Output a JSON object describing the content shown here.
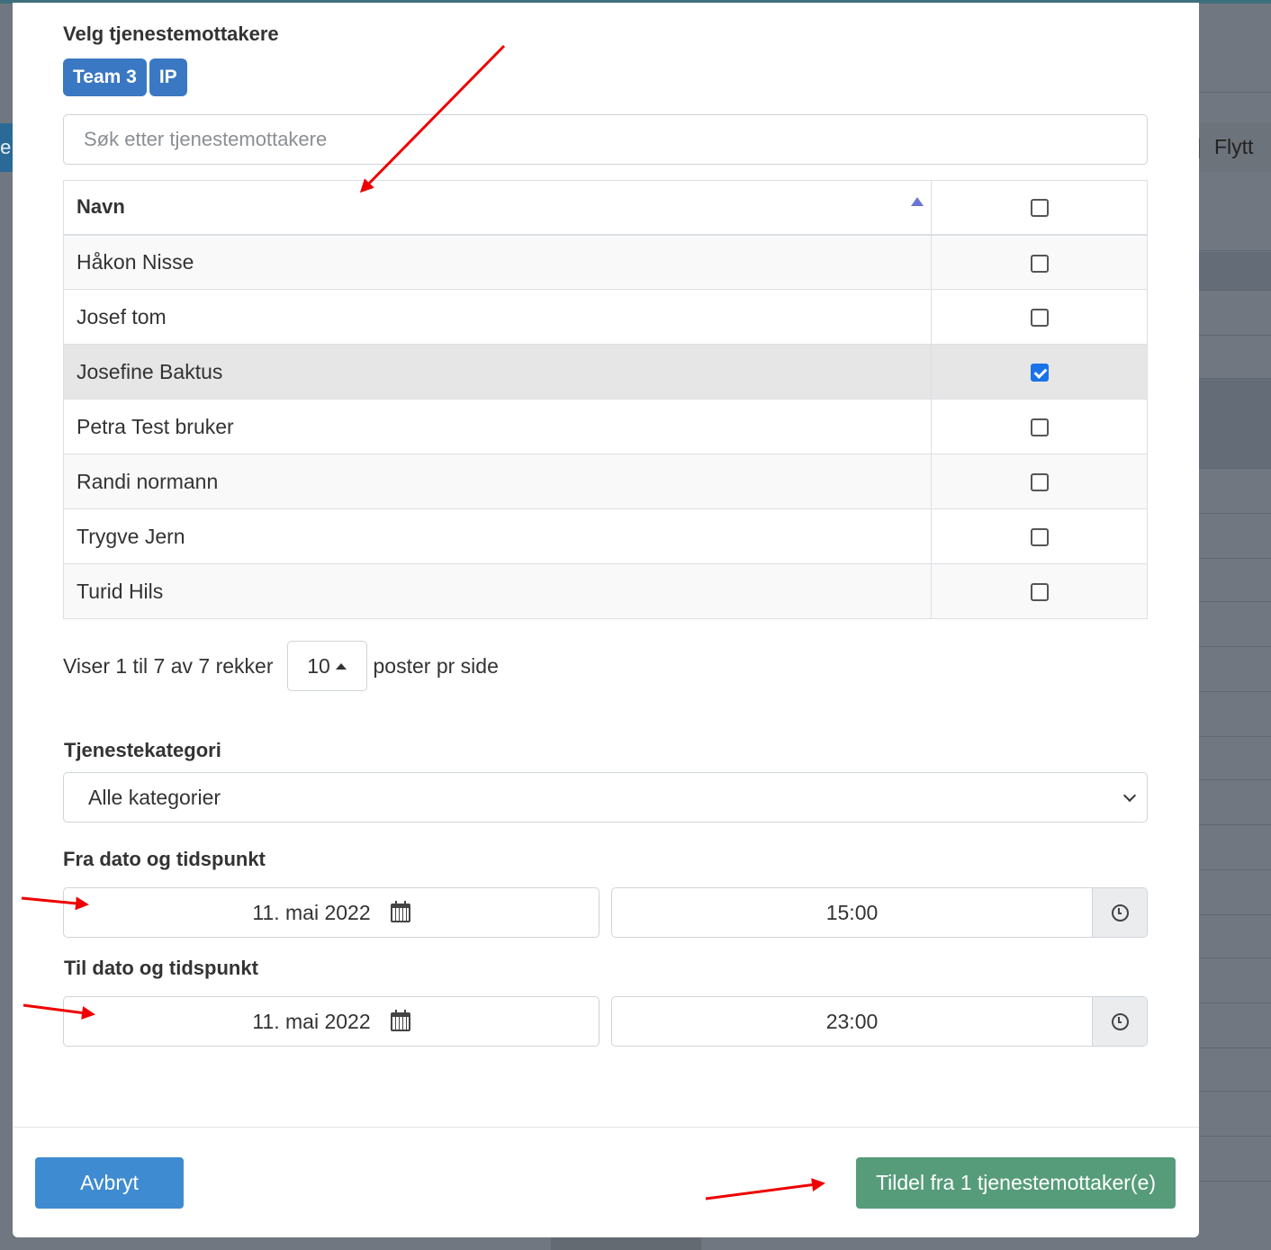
{
  "background": {
    "left_tab_text": "te",
    "right_button_label": "Flytt"
  },
  "modal": {
    "recipients_label": "Velg tjenestemottakere",
    "badges": [
      "Team 3",
      "IP"
    ],
    "search": {
      "placeholder": "Søk etter tjenestemottakere",
      "value": ""
    },
    "table": {
      "column_name": "Navn",
      "rows": [
        {
          "name": "Håkon Nisse",
          "checked": false
        },
        {
          "name": "Josef tom",
          "checked": false
        },
        {
          "name": "Josefine Baktus",
          "checked": true
        },
        {
          "name": "Petra Test bruker",
          "checked": false
        },
        {
          "name": "Randi normann",
          "checked": false
        },
        {
          "name": "Trygve Jern",
          "checked": false
        },
        {
          "name": "Turid Hils",
          "checked": false
        }
      ]
    },
    "pagination": {
      "summary": "Viser 1 til 7 av 7 rekker",
      "page_size": "10",
      "suffix": "poster pr side"
    },
    "category": {
      "label": "Tjenestekategori",
      "selected": "Alle kategorier"
    },
    "from": {
      "label": "Fra dato og tidspunkt",
      "date": "11. mai 2022",
      "time": "15:00"
    },
    "to": {
      "label": "Til dato og tidspunkt",
      "date": "11. mai 2022",
      "time": "23:00"
    },
    "buttons": {
      "cancel": "Avbryt",
      "assign": "Tildel fra 1 tjenestemottaker(e)"
    }
  },
  "colors": {
    "badge": "#3a78c3",
    "cancel_button": "#3e8bd1",
    "assign_button": "#569c7a",
    "annotation_arrow": "#ee0000"
  },
  "icons": [
    "sort-ascending-icon",
    "calendar-icon",
    "clock-icon",
    "chevron-down-icon",
    "caret-up-icon"
  ]
}
